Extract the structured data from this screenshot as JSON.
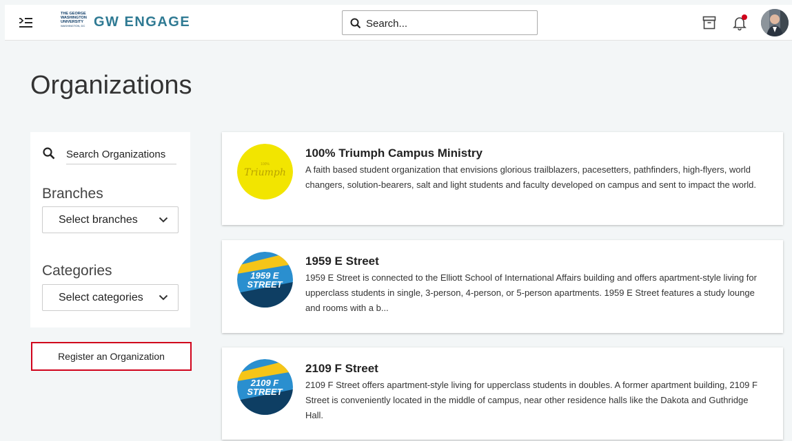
{
  "header": {
    "logo_lines": [
      "THE GEORGE",
      "WASHINGTON",
      "UNIVERSITY",
      "WASHINGTON, DC"
    ],
    "app_title": "GW ENGAGE",
    "search_placeholder": "Search...",
    "icons": [
      "menu-icon",
      "search-icon",
      "archive-icon",
      "bell-icon",
      "avatar"
    ],
    "notification_dot_color": "#d0021b"
  },
  "page": {
    "title": "Organizations"
  },
  "filters": {
    "search_placeholder": "Search Organizations",
    "branches_heading": "Branches",
    "branches_select": "Select branches",
    "categories_heading": "Categories",
    "categories_select": "Select categories"
  },
  "register_button": "Register an Organization",
  "organizations": [
    {
      "name": "100% Triumph Campus Ministry",
      "description": "A faith based student organization that envisions glorious trailblazers, pacesetters, pathfinders, high-flyers, world changers, solution-bearers, salt and light students and faculty developed on campus and sent to impact the world.",
      "logo_text": "Triumph",
      "logo_color": "#f2e500"
    },
    {
      "name": "1959 E Street",
      "description": "1959 E Street is connected to the Elliott School of International Affairs building and offers apartment-style living for upperclass students in single, 3-person, 4-person, or 5-person apartments. 1959 E Street features a study lounge and rooms with a b...",
      "logo_line1": "1959 E",
      "logo_line2": "STREET",
      "logo_color": "#2a8fcf"
    },
    {
      "name": "2109 F Street",
      "description": "2109 F Street offers apartment-style living for upperclass students in doubles. A former apartment building, 2109 F Street is conveniently located in the middle of campus, near other residence halls like the Dakota and Guthridge Hall.",
      "logo_line1": "2109 F",
      "logo_line2": "STREET",
      "logo_color": "#2a8fcf"
    }
  ]
}
